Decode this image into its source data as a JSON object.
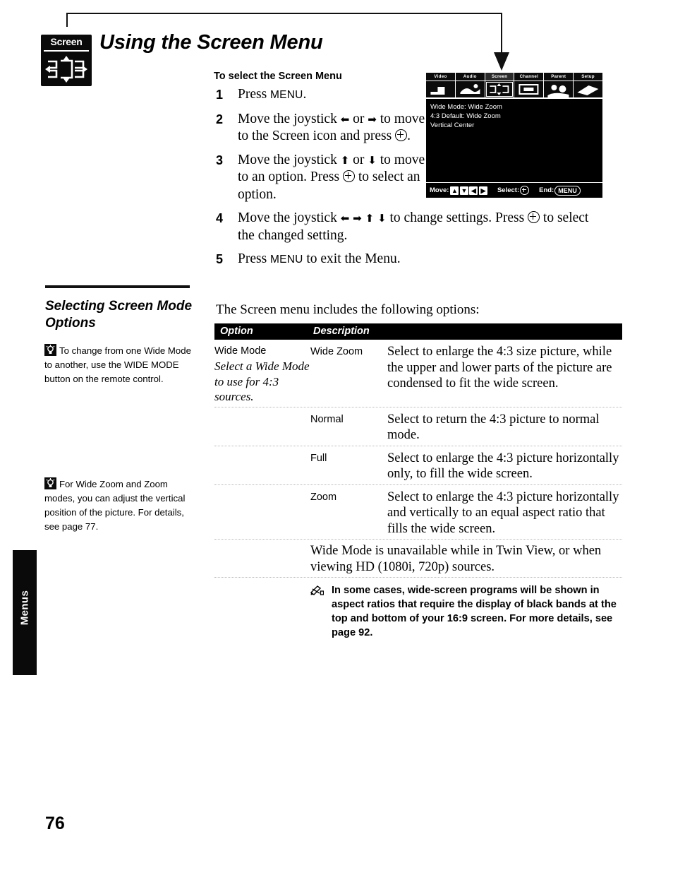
{
  "document": {
    "page_number": "76",
    "side_tab_label": "Menus"
  },
  "header": {
    "badge_label": "Screen",
    "badge_icon": "screen-mode-icon",
    "title": "Using the Screen Menu"
  },
  "procedure": {
    "heading": "To select the Screen Menu",
    "steps": [
      {
        "num": "1",
        "text_before": "Press ",
        "keyword": "MENU",
        "text_after": "."
      },
      {
        "num": "2",
        "text": "Move the joystick ← or → to move to the Screen icon and press ⊕."
      },
      {
        "num": "3",
        "text": "Move the joystick ↑ or ↓ to move to an option. Press ⊕ to select an option."
      },
      {
        "num": "4",
        "text": "Move the joystick ← → ↑ ↓ to change settings. Press ⊕ to select the changed setting."
      },
      {
        "num": "5",
        "text_before": "Press ",
        "keyword": "MENU",
        "text_after": " to exit the Menu."
      }
    ]
  },
  "osd": {
    "tabs": [
      {
        "label": "Video",
        "selected": false
      },
      {
        "label": "Audio",
        "selected": false
      },
      {
        "label": "Screen",
        "selected": true
      },
      {
        "label": "Channel",
        "selected": false
      },
      {
        "label": "Parent",
        "selected": false
      },
      {
        "label": "Setup",
        "selected": false
      }
    ],
    "menu_items": [
      "Wide Mode: Wide Zoom",
      "4:3 Default: Wide Zoom",
      "Vertical Center"
    ],
    "statusbar": {
      "move_label": "Move:",
      "move_keys": [
        "▲",
        "▼",
        "◀",
        "▶"
      ],
      "select_label": "Select:",
      "end_label": "End:",
      "end_button": "MENU"
    }
  },
  "sidebar": {
    "section_title": "Selecting Screen Mode Options",
    "notes": [
      {
        "icon": "lightbulb-icon",
        "text": "To change from one Wide Mode to another, use the WIDE MODE button on the remote control."
      },
      {
        "icon": "lightbulb-icon",
        "text": "For Wide Zoom and Zoom modes, you can adjust the vertical position of the picture. For details, see page 77."
      }
    ]
  },
  "main": {
    "intro": "The Screen menu includes the following options:",
    "table": {
      "headers": {
        "option": "Option",
        "description": "Description"
      },
      "option_name": "Wide Mode",
      "option_subtitle": "Select a Wide Mode to use for 4:3 sources.",
      "rows": [
        {
          "mode": "Wide Zoom",
          "description": "Select to enlarge the 4:3 size picture, while the upper and lower parts of the picture are condensed to fit the wide screen."
        },
        {
          "mode": "Normal",
          "description": "Select to return the 4:3 picture to normal mode."
        },
        {
          "mode": "Full",
          "description": "Select to enlarge the 4:3 picture horizontally only, to fill the wide screen."
        },
        {
          "mode": "Zoom",
          "description": "Select to enlarge the 4:3 picture horizontally and vertically to an equal aspect ratio that fills the wide screen."
        }
      ],
      "tail_note": "Wide Mode is unavailable while in Twin View, or when viewing HD (1080i, 720p) sources.",
      "warning": {
        "icon": "note-pencil-icon",
        "text": "In some cases, wide-screen programs will be shown in aspect ratios that require the display of black bands at the top and bottom of your 16:9 screen. For more details, see page 92."
      }
    }
  },
  "colors": {
    "ink": "#000000",
    "paper": "#ffffff",
    "rule": "#b8b8b8"
  }
}
